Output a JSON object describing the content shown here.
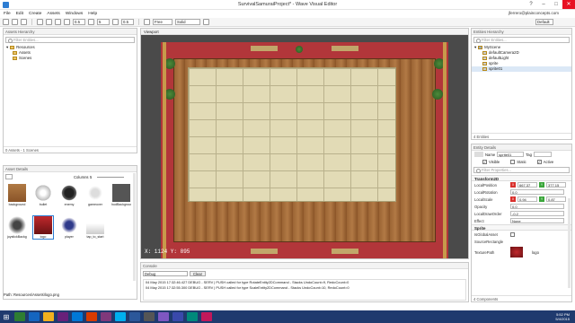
{
  "window": {
    "title": "SurvivalSamuraiProject* - Wave Visual Editor",
    "user": "jferrero@plainconcepts.com"
  },
  "menu": [
    "File",
    "Edit",
    "Create",
    "Assets",
    "Windows",
    "Help"
  ],
  "toolbar": {
    "snap_value": "0.5",
    "angle_value": "5",
    "scale_value": "0.5",
    "camera_mode": "Free",
    "render_mode": "Solid",
    "layout": "Default"
  },
  "assets_hierarchy": {
    "title": "Assets Hierarchy",
    "filter_placeholder": "Filter Entities...",
    "items": [
      {
        "label": "Resources"
      },
      {
        "label": "Assets"
      },
      {
        "label": "Scenes"
      }
    ],
    "status": "0 Assets - 1 Scenes"
  },
  "asset_details": {
    "title": "Asset Details",
    "columns_label": "Columns",
    "columns_value": "5",
    "assets": [
      "background",
      "bullet",
      "enemy",
      "gameover",
      "hudBackground",
      "joystickBackgro..",
      "logo",
      "player",
      "tap_to_start"
    ],
    "path_label": "Path:",
    "path_value": "Resources\\Assets\\logo.png"
  },
  "viewport": {
    "tab": "Viewport",
    "coords": "X: 1124 Y: 895"
  },
  "console": {
    "title": "Console",
    "level": "Debug",
    "clear_label": "Clear",
    "lines": [
      "04 May 2015 17:32:46.427 DEBUG - SERV | PUSH called for type RotateEntity2DCommand - Stacks UndoCount=9, RedoCount=0",
      "04 May 2015 17:32:55.300 DEBUG - SERV | PUSH called for type ScaleEntity2DCommand - Stacks UndoCount=10, RedoCount=0"
    ]
  },
  "entities_hierarchy": {
    "title": "Entities Hierarchy",
    "filter_placeholder": "Filter Entities...",
    "root": "MyScene",
    "items": [
      "defaultCamera2D",
      "defaultLight",
      "sprite",
      "sprite01"
    ],
    "status": "4 Entities"
  },
  "entity_details": {
    "title": "Entity Details",
    "name_label": "Name",
    "name_value": "sprite01",
    "tag_label": "Tag",
    "visible_label": "Visible",
    "static_label": "Static",
    "active_label": "Active",
    "filter_placeholder": "Filter Properties...",
    "transform_section": "Transform2D",
    "local_position_label": "LocalPosition",
    "local_position": {
      "x": "667.37",
      "y": "377.15"
    },
    "local_rotation_label": "LocalRotation",
    "local_rotation": "0.0",
    "local_scale_label": "LocalScale",
    "local_scale": {
      "x": "0.94",
      "y": "0.87"
    },
    "opacity_label": "Opacity",
    "opacity": "0.0",
    "local_draw_order_label": "LocalDrawOrder",
    "local_draw_order": "-0.2",
    "effect_label": "Effect",
    "effect_value": "None",
    "sprite_section": "Sprite",
    "is_global_asset_label": "IsGlobalAsset",
    "source_rectangle_label": "SourceRectangle",
    "texture_path_label": "TexturePath",
    "texture_name": "logo",
    "status": "4 Components"
  },
  "clock": {
    "time": "5:52 PM",
    "date": "5/4/2015"
  },
  "colors": {
    "accent": "#2d7dd2",
    "x_axis": "#d9302c",
    "y_axis": "#3aa63a",
    "taskbar": "#1f3a6e"
  }
}
